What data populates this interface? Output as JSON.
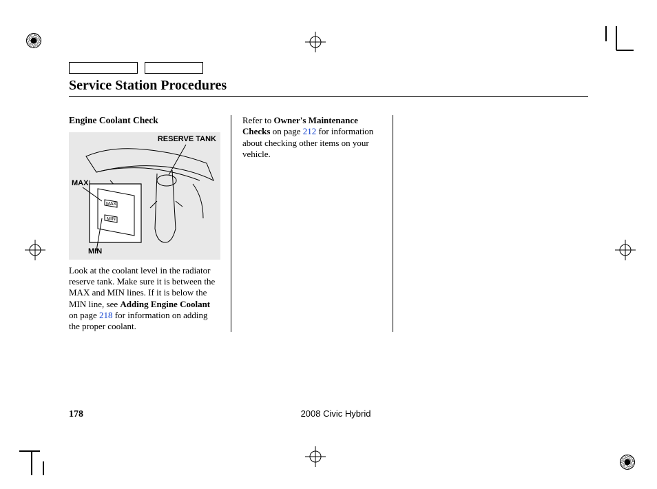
{
  "page": {
    "title": "Service Station Procedures",
    "number": "178",
    "model": "2008  Civic  Hybrid"
  },
  "col1": {
    "subhead": "Engine Coolant Check",
    "diagram_labels": {
      "reserve_tank": "RESERVE TANK",
      "max": "MAX",
      "min": "MIN"
    },
    "para_parts": {
      "p1": "Look at the coolant level in the radiator reserve tank. Make sure it is between the MAX and MIN lines. If it is below the MIN line, see ",
      "b1": "Adding Engine Coolant",
      "p2": " on page ",
      "link1": "218",
      "p3": " for information on adding the proper coolant."
    }
  },
  "col2": {
    "para_parts": {
      "p1": "Refer to ",
      "b1": "Owner's Maintenance Checks",
      "p2": " on page ",
      "link1": "212",
      "p3": " for information about checking other items on your vehicle."
    }
  }
}
